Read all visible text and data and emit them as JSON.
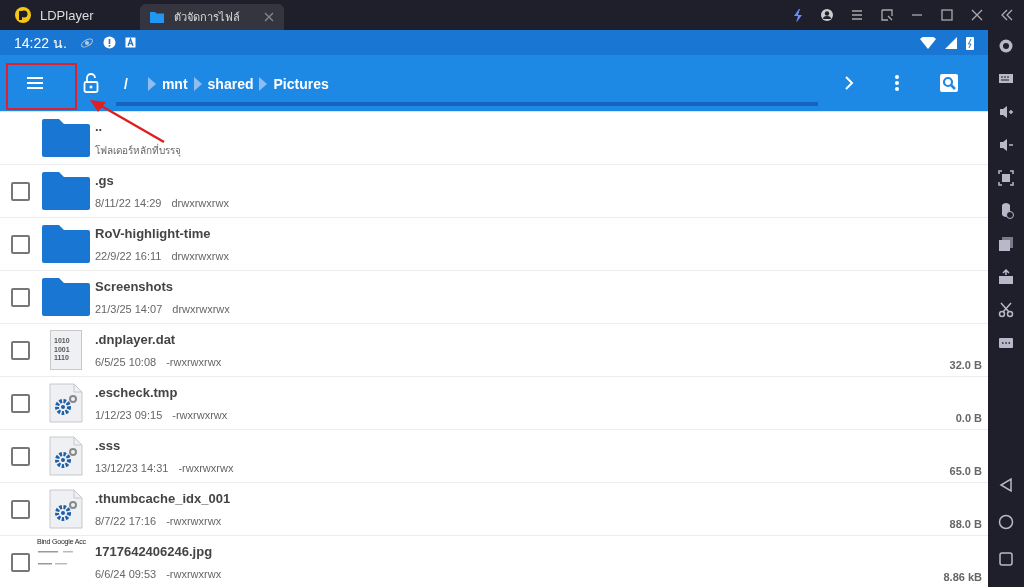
{
  "window": {
    "app_title": "LDPlayer",
    "tab": {
      "title": "ตัวจัดการไฟล์",
      "selected": true
    }
  },
  "status_bar": {
    "time": "14:22 น."
  },
  "toolbar": {
    "breadcrumb": [
      {
        "label": "/"
      },
      {
        "label": "mnt"
      },
      {
        "label": "shared"
      },
      {
        "label": "Pictures"
      }
    ]
  },
  "annotations": {
    "highlight_frame": true,
    "arrow": true
  },
  "files": [
    {
      "kind": "folder",
      "name": "..",
      "detail": "โฟลเดอร์หลักที่บรรจุ"
    },
    {
      "kind": "folder",
      "name": ".gs",
      "date": "8/11/22 14:29",
      "perms": "drwxrwxrwx",
      "checked": false
    },
    {
      "kind": "folder",
      "name": "RoV-highlight-time",
      "date": "22/9/22 16:11",
      "perms": "drwxrwxrwx",
      "checked": false
    },
    {
      "kind": "folder",
      "name": "Screenshots",
      "date": "21/3/25 14:07",
      "perms": "drwxrwxrwx",
      "checked": false
    },
    {
      "kind": "binary",
      "name": ".dnplayer.dat",
      "date": "6/5/25 10:08",
      "perms": "-rwxrwxrwx",
      "size": "32.0 B",
      "icon_text": [
        "1010",
        "1001",
        "1110"
      ],
      "checked": false
    },
    {
      "kind": "settings",
      "name": ".escheck.tmp",
      "date": "1/12/23 09:15",
      "perms": "-rwxrwxrwx",
      "size": "0.0 B",
      "checked": false
    },
    {
      "kind": "settings",
      "name": ".sss",
      "date": "13/12/23 14:31",
      "perms": "-rwxrwxrwx",
      "size": "65.0 B",
      "checked": false
    },
    {
      "kind": "settings",
      "name": ".thumbcache_idx_001",
      "date": "8/7/22 17:16",
      "perms": "-rwxrwxrwx",
      "size": "88.0 B",
      "checked": false
    },
    {
      "kind": "image",
      "name": "1717642406246.jpg",
      "date": "6/6/24 09:53",
      "perms": "-rwxrwxrwx",
      "size": "8.86 kB",
      "thumb_title": "Bind Google Acc",
      "checked": false
    }
  ]
}
